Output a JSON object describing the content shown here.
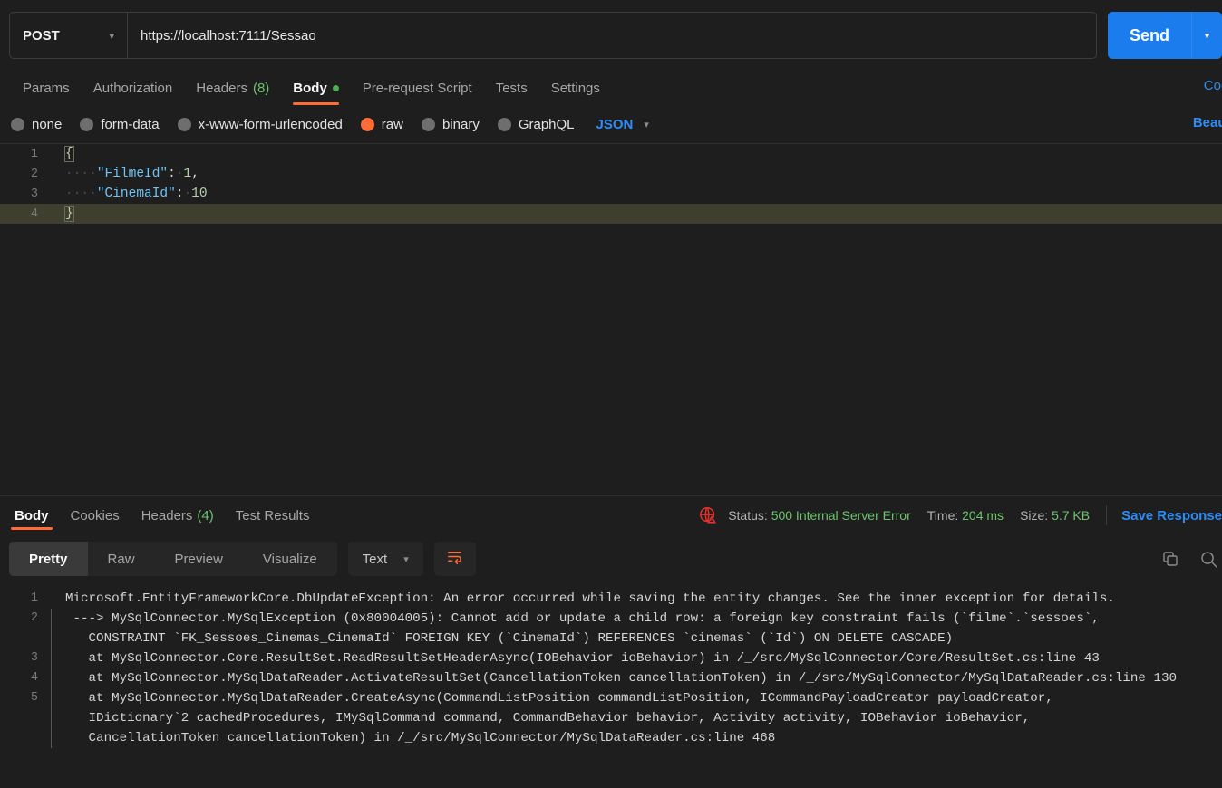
{
  "request": {
    "method": "POST",
    "url": "https://localhost:7111/Sessao",
    "send_label": "Send",
    "tabs": [
      {
        "label": "Params",
        "count": "",
        "active": false,
        "dot": false
      },
      {
        "label": "Authorization",
        "count": "",
        "active": false,
        "dot": false
      },
      {
        "label": "Headers",
        "count": "(8)",
        "active": false,
        "dot": false
      },
      {
        "label": "Body",
        "count": "",
        "active": true,
        "dot": true
      },
      {
        "label": "Pre-request Script",
        "count": "",
        "active": false,
        "dot": false
      },
      {
        "label": "Tests",
        "count": "",
        "active": false,
        "dot": false
      },
      {
        "label": "Settings",
        "count": "",
        "active": false,
        "dot": false
      }
    ],
    "cookies_link": "Cookies",
    "beautify_link": "Beautify",
    "body_types": [
      {
        "label": "none",
        "selected": false
      },
      {
        "label": "form-data",
        "selected": false
      },
      {
        "label": "x-www-form-urlencoded",
        "selected": false
      },
      {
        "label": "raw",
        "selected": true
      },
      {
        "label": "binary",
        "selected": false
      },
      {
        "label": "GraphQL",
        "selected": false
      }
    ],
    "raw_format": "JSON",
    "body_lines": [
      {
        "n": "1",
        "open_brace": "{",
        "active": false
      },
      {
        "n": "2",
        "indent": "····",
        "key": "\"FilmeId\"",
        "colon": ":",
        "space": "·",
        "value": "1",
        "tail": ",",
        "active": false
      },
      {
        "n": "3",
        "indent": "····",
        "key": "\"CinemaId\"",
        "colon": ":",
        "space": "·",
        "value": "10",
        "tail": "",
        "active": false
      },
      {
        "n": "4",
        "close_brace": "}",
        "active": true
      }
    ]
  },
  "response": {
    "tabs": [
      {
        "label": "Body",
        "count": "",
        "active": true
      },
      {
        "label": "Cookies",
        "count": "",
        "active": false
      },
      {
        "label": "Headers",
        "count": "(4)",
        "active": false
      },
      {
        "label": "Test Results",
        "count": "",
        "active": false
      }
    ],
    "status_label": "Status:",
    "status_value": "500 Internal Server Error",
    "time_label": "Time:",
    "time_value": "204 ms",
    "size_label": "Size:",
    "size_value": "5.7 KB",
    "save_response": "Save Response",
    "view_modes": [
      {
        "label": "Pretty",
        "active": true
      },
      {
        "label": "Raw",
        "active": false
      },
      {
        "label": "Preview",
        "active": false
      },
      {
        "label": "Visualize",
        "active": false
      }
    ],
    "format": "Text",
    "lines": [
      {
        "n": "1",
        "folded": false,
        "text": "Microsoft.EntityFrameworkCore.DbUpdateException: An error occurred while saving the entity changes. See the inner exception for details."
      },
      {
        "n": "2",
        "folded": true,
        "text": " ---> MySqlConnector.MySqlException (0x80004005): Cannot add or update a child row: a foreign key constraint fails (`filme`.`sessoes`,\n   CONSTRAINT `FK_Sessoes_Cinemas_CinemaId` FOREIGN KEY (`CinemaId`) REFERENCES `cinemas` (`Id`) ON DELETE CASCADE)"
      },
      {
        "n": "3",
        "folded": true,
        "text": "   at MySqlConnector.Core.ResultSet.ReadResultSetHeaderAsync(IOBehavior ioBehavior) in /_/src/MySqlConnector/Core/ResultSet.cs:line 43"
      },
      {
        "n": "4",
        "folded": true,
        "text": "   at MySqlConnector.MySqlDataReader.ActivateResultSet(CancellationToken cancellationToken) in /_/src/MySqlConnector/MySqlDataReader.cs:line 130"
      },
      {
        "n": "5",
        "folded": true,
        "text": "   at MySqlConnector.MySqlDataReader.CreateAsync(CommandListPosition commandListPosition, ICommandPayloadCreator payloadCreator,\n   IDictionary`2 cachedProcedures, IMySqlCommand command, CommandBehavior behavior, Activity activity, IOBehavior ioBehavior,\n   CancellationToken cancellationToken) in /_/src/MySqlConnector/MySqlDataReader.cs:line 468"
      }
    ]
  },
  "colors": {
    "accent_orange": "#ff6c37",
    "link_blue": "#2d8cf5",
    "send_blue": "#1a7ced",
    "status_green": "#6dc36d",
    "error_red": "#e03131",
    "bg": "#1e1e1e"
  }
}
